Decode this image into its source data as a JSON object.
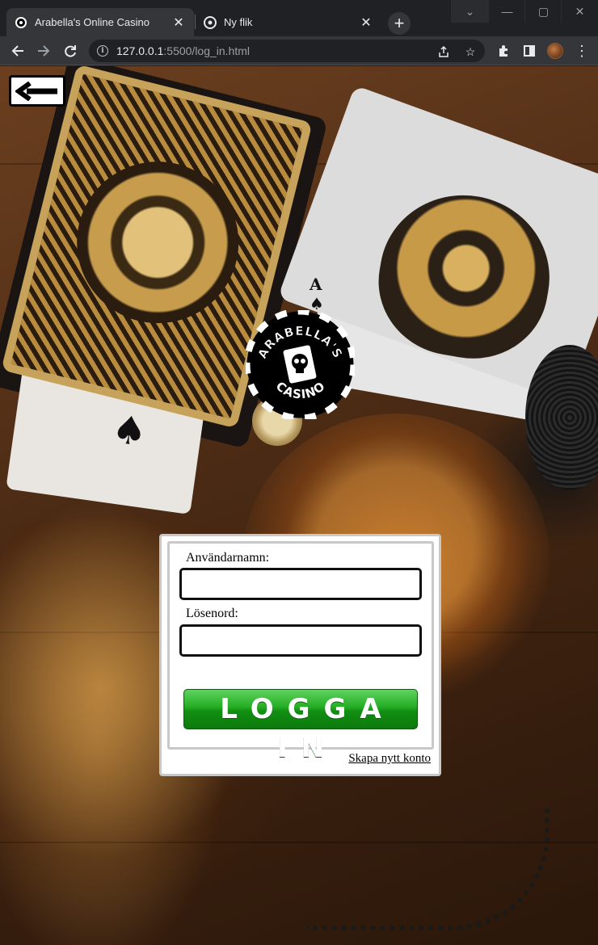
{
  "browser": {
    "tabs": [
      {
        "title": "Arabella's Online Casino",
        "favicon": "casino-chip-icon",
        "active": true
      },
      {
        "title": "Ny flik",
        "favicon": "chrome-icon",
        "active": false
      }
    ],
    "url_host": "127.0.0.1",
    "url_rest": ":5500/log_in.html",
    "window_controls": [
      "chevron-down-icon",
      "minimize-icon",
      "maximize-icon",
      "close-icon"
    ]
  },
  "logo": {
    "top_text": "ARABELLA'S",
    "bottom_text": "CASINO"
  },
  "login": {
    "username_label": "Användarnamn:",
    "username_value": "",
    "password_label": "Lösenord:",
    "password_value": "",
    "submit_label": "LOGGA IN",
    "create_account_link": "Skapa nytt konto"
  },
  "colors": {
    "login_button_green": "#1fa31f",
    "field_border": "#111111",
    "panel_border": "#c8c8c8"
  }
}
